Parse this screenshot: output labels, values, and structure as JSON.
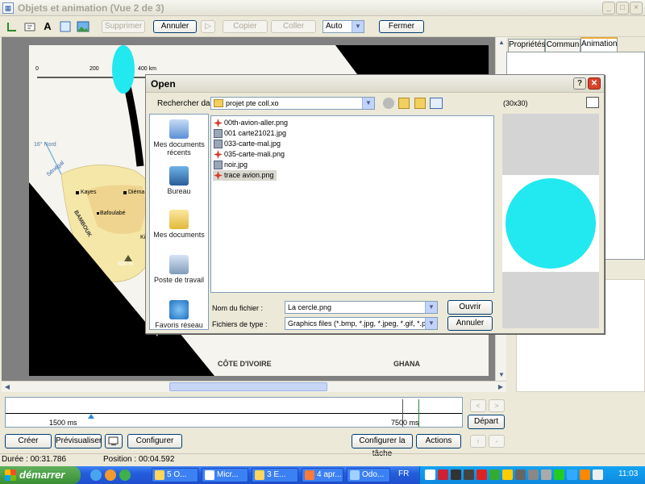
{
  "window": {
    "title": "Objets et animation  (Vue 2 de 3)",
    "controls": [
      "_",
      "□",
      "×"
    ]
  },
  "toolbar": {
    "buttons": [
      "Supprimer",
      "Annuler",
      "Copier",
      "Coller",
      "Fermer"
    ],
    "redo_glyph": "▷",
    "zoom_value": "Auto"
  },
  "map": {
    "scale_labels": [
      "0",
      "200",
      "400 km"
    ],
    "labels": [
      "16° Nord",
      "Sénégal",
      "Kayes",
      "Diéma",
      "BAMBOUK",
      "Bafoulabé",
      "806 m",
      "Ki",
      "CÔTE D'IVOIRE",
      "GHANA"
    ]
  },
  "right_panel": {
    "tabs": [
      "Propriétés",
      "Commun",
      "Animation"
    ]
  },
  "dialog": {
    "title": "Open",
    "look_in_label": "Rechercher dans :",
    "look_in_value": "projet pte coll.xo",
    "places": [
      "Mes documents récents",
      "Bureau",
      "Mes documents",
      "Poste de travail",
      "Favoris réseau"
    ],
    "files": [
      {
        "name": "00th-avion-aller.png",
        "icon": "png-icon"
      },
      {
        "name": "001 carte21021.jpg",
        "icon": "jpg-icon"
      },
      {
        "name": "033-carte-mal.jpg",
        "icon": "jpg-icon"
      },
      {
        "name": "035-carte-mali.png",
        "icon": "png-icon"
      },
      {
        "name": "noir.jpg",
        "icon": "jpg-icon"
      },
      {
        "name": "trace avion.png",
        "icon": "png-icon"
      }
    ],
    "selected_file": "trace avion.png",
    "filename_label": "Nom du fichier :",
    "filename_value": "La cercle.png",
    "filetype_label": "Fichiers de type :",
    "filetype_value": "Graphics files (*.bmp, *.jpg, *.jpeg, *.gif, *.png)",
    "open_button": "Ouvrir",
    "cancel_button": "Annuler",
    "preview_size": "(30x30)",
    "preview_color": "#22e8f0"
  },
  "timeline": {
    "left_time": "1500 ms",
    "right_time": "7500 ms",
    "depart_button": "Départ",
    "nav_prev": "<",
    "nav_next": ">",
    "up": "↑",
    "down": "-"
  },
  "bottom_buttons": {
    "creer": "Créer",
    "previsualiser": "Prévisualiser",
    "configurer": "Configurer",
    "configurer_tache": "Configurer la tâche",
    "actions": "Actions"
  },
  "status": {
    "duree": "Durée : 00:31.786",
    "position": "Position : 00:04.592"
  },
  "taskbar": {
    "start": "démarrer",
    "tasks": [
      "5 O...",
      "Micr...",
      "3 E...",
      "4 apr...",
      "Odo..."
    ],
    "lang": "FR",
    "clock": "11:03"
  }
}
